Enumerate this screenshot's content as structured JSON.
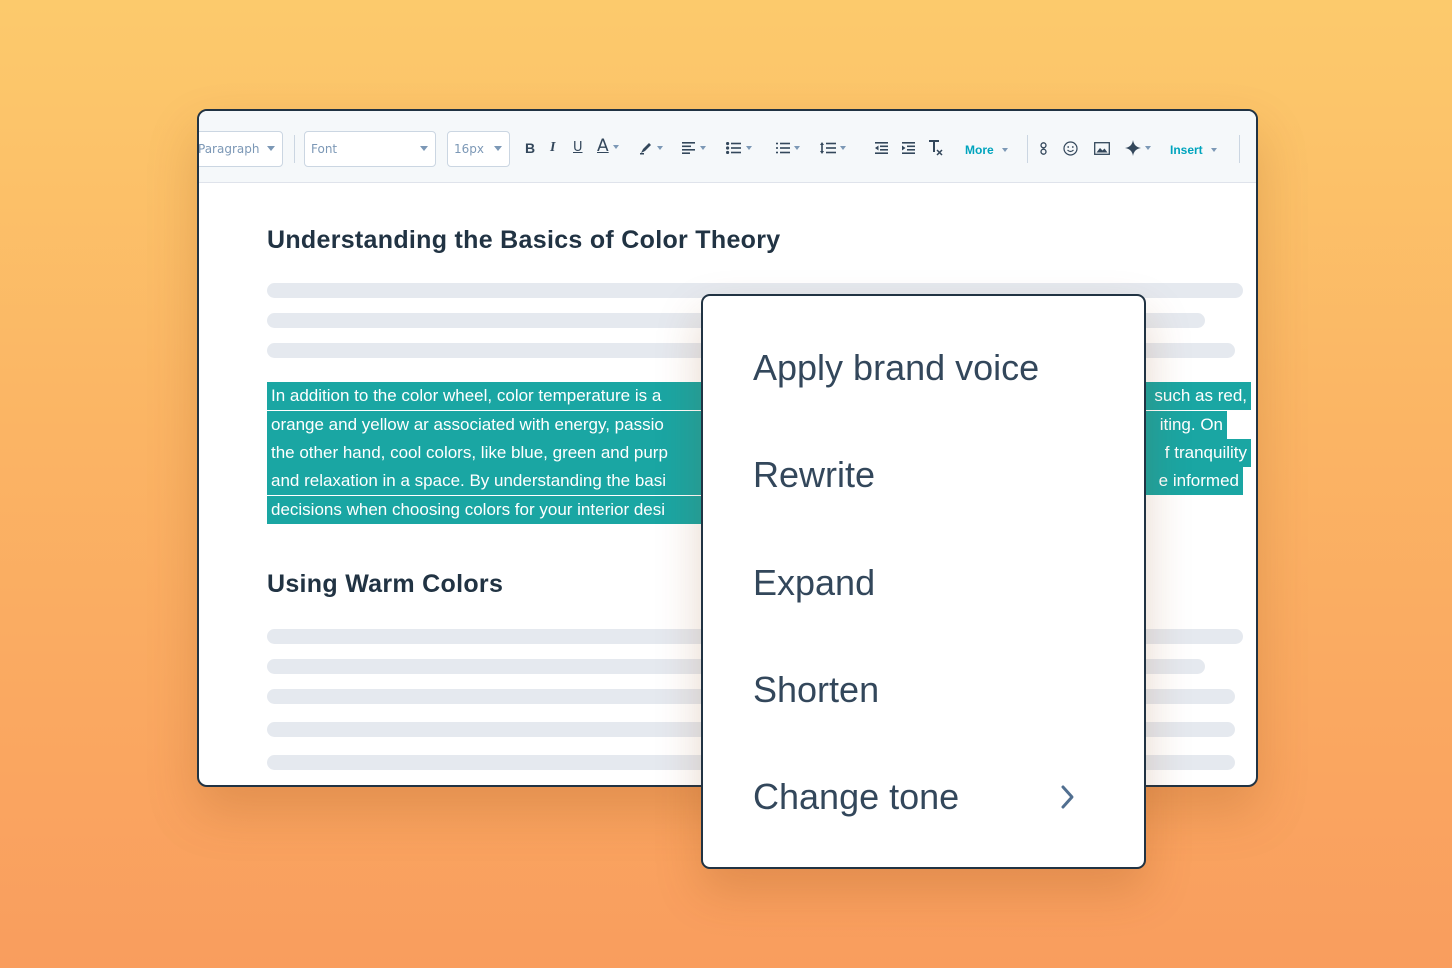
{
  "toolbar": {
    "paragraph_select": "Paragraph",
    "font_select": "Font",
    "size_select": "16px",
    "bold_label": "B",
    "italic_label": "I",
    "underline_label": "U",
    "font_color_label": "A",
    "more_label": "More",
    "insert_label": "Insert"
  },
  "document": {
    "heading1": "Understanding the Basics of Color Theory",
    "highlighted_lines": [
      "In addition to the color wheel, color temperature is a",
      "orange and yellow ar associated with energy, passio",
      "the other hand, cool colors, like blue, green and purp",
      "and relaxation in a space. By understanding the basi",
      "decisions when choosing colors for your interior desi"
    ],
    "highlighted_tails": [
      "such as red,",
      "iting. On",
      "f tranquility",
      "e informed"
    ],
    "heading2": "Using Warm Colors"
  },
  "menu": {
    "items": [
      {
        "label": "Apply brand voice"
      },
      {
        "label": "Rewrite"
      },
      {
        "label": "Expand"
      },
      {
        "label": "Shorten"
      },
      {
        "label": "Change tone",
        "has_submenu": true
      }
    ]
  },
  "colors": {
    "highlight": "#1aa6a3",
    "accent_link": "#00a4bd",
    "heading": "#213343",
    "text": "#33475b",
    "skeleton": "#e5e9ef"
  }
}
